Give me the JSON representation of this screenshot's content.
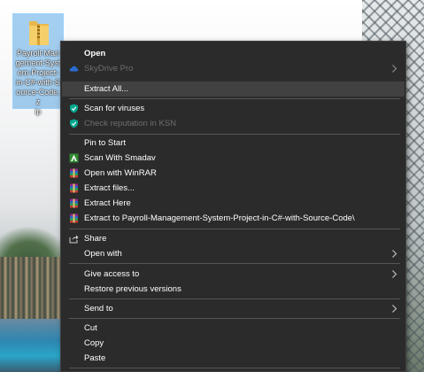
{
  "desktop": {
    "icon_label": "Payroll-Management-System-Project-in-C#-with-Source-Code.zip",
    "icon_label_lines": [
      "Payroll-Man",
      "gement-Syst",
      "em-Project-",
      "in-C#-with-S",
      "ource-Code.z",
      "ip"
    ]
  },
  "menu": {
    "items": [
      {
        "label": "Open",
        "bold": true,
        "icon": "",
        "disabled": false,
        "submenu": false
      },
      {
        "label": "SkyDrive Pro",
        "bold": false,
        "icon": "skydrive-cloud-icon",
        "disabled": true,
        "submenu": true
      },
      {
        "label": "Extract All...",
        "bold": false,
        "icon": "",
        "disabled": false,
        "submenu": false
      },
      {
        "label": "Scan for viruses",
        "bold": false,
        "icon": "kaspersky-shield-icon",
        "disabled": false,
        "submenu": false
      },
      {
        "label": "Check reputation in KSN",
        "bold": false,
        "icon": "kaspersky-shield-icon",
        "disabled": true,
        "submenu": false
      },
      {
        "label": "Pin to Start",
        "bold": false,
        "icon": "",
        "disabled": false,
        "submenu": false
      },
      {
        "label": "Scan With Smadav",
        "bold": false,
        "icon": "smadav-icon",
        "disabled": false,
        "submenu": false
      },
      {
        "label": "Open with WinRAR",
        "bold": false,
        "icon": "winrar-icon",
        "disabled": false,
        "submenu": false
      },
      {
        "label": "Extract files...",
        "bold": false,
        "icon": "winrar-icon",
        "disabled": false,
        "submenu": false
      },
      {
        "label": "Extract Here",
        "bold": false,
        "icon": "winrar-icon",
        "disabled": false,
        "submenu": false
      },
      {
        "label": "Extract to Payroll-Management-System-Project-in-C#-with-Source-Code\\",
        "bold": false,
        "icon": "winrar-icon",
        "disabled": false,
        "submenu": false
      },
      {
        "label": "Share",
        "bold": false,
        "icon": "share-icon",
        "disabled": false,
        "submenu": false
      },
      {
        "label": "Open with",
        "bold": false,
        "icon": "",
        "disabled": false,
        "submenu": true
      },
      {
        "label": "Give access to",
        "bold": false,
        "icon": "",
        "disabled": false,
        "submenu": true
      },
      {
        "label": "Restore previous versions",
        "bold": false,
        "icon": "",
        "disabled": false,
        "submenu": false
      },
      {
        "label": "Send to",
        "bold": false,
        "icon": "",
        "disabled": false,
        "submenu": true
      },
      {
        "label": "Cut",
        "bold": false,
        "icon": "",
        "disabled": false,
        "submenu": false
      },
      {
        "label": "Copy",
        "bold": false,
        "icon": "",
        "disabled": false,
        "submenu": false
      },
      {
        "label": "Paste",
        "bold": false,
        "icon": "",
        "disabled": false,
        "submenu": false
      }
    ]
  },
  "colors": {
    "menu_bg": "#2b2b2b",
    "menu_text": "#ffffff",
    "menu_disabled_text": "#6d6d6d",
    "hover_bg": "#414141",
    "separator": "#555555",
    "selection_bg": "#0078d7",
    "kaspersky_green": "#00a88e",
    "skydrive_blue": "#2b6cd4"
  }
}
